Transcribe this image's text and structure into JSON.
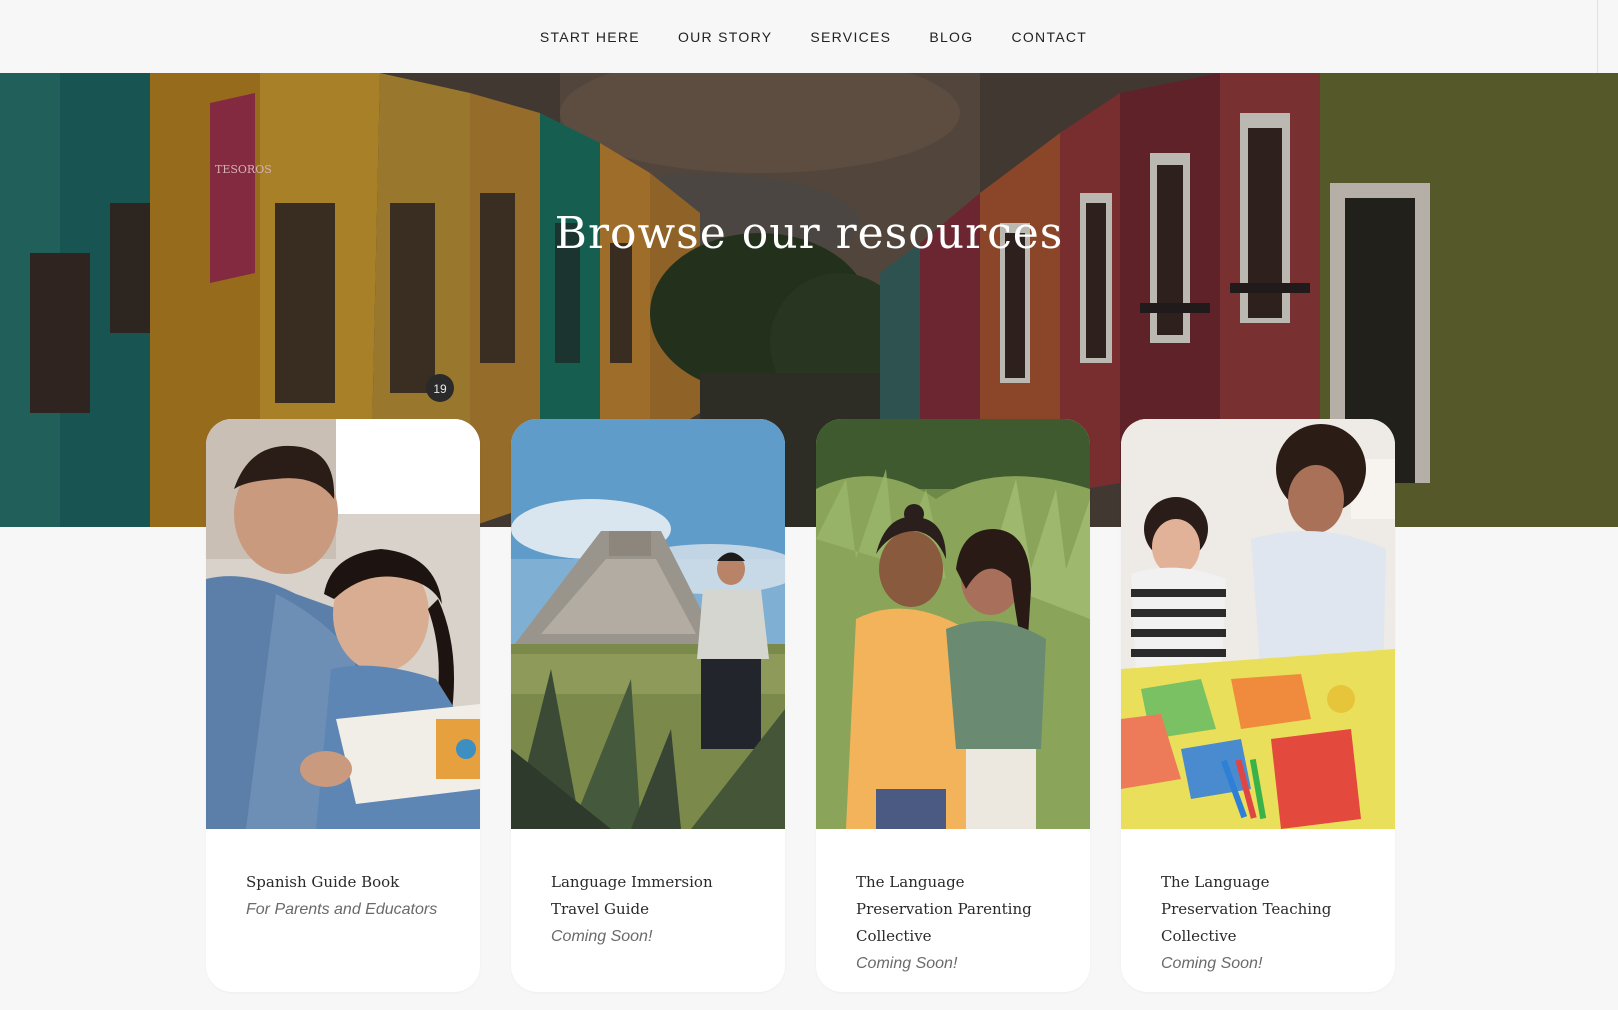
{
  "nav": {
    "items": [
      {
        "label": "START HERE"
      },
      {
        "label": "OUR STORY"
      },
      {
        "label": "SERVICES"
      },
      {
        "label": "BLOG"
      },
      {
        "label": "CONTACT"
      }
    ]
  },
  "hero": {
    "title": "Browse our resources",
    "sign_text": "TESOROS",
    "house_number": "19"
  },
  "cards": [
    {
      "title": "Spanish Guide Book",
      "subtitle": "For Parents and Educators"
    },
    {
      "title": "Language Immersion Travel Guide",
      "subtitle": "Coming Soon!"
    },
    {
      "title": "The Language Preservation Parenting Collective",
      "subtitle": "Coming Soon!"
    },
    {
      "title": "The Language Preservation Teaching Collective",
      "subtitle": "Coming Soon!"
    }
  ],
  "colors": {
    "background": "#f7f7f7",
    "card": "#ffffff",
    "nav_text": "#222222",
    "title_text": "#2a2a2a",
    "subtitle_text": "#6a6a6a"
  }
}
